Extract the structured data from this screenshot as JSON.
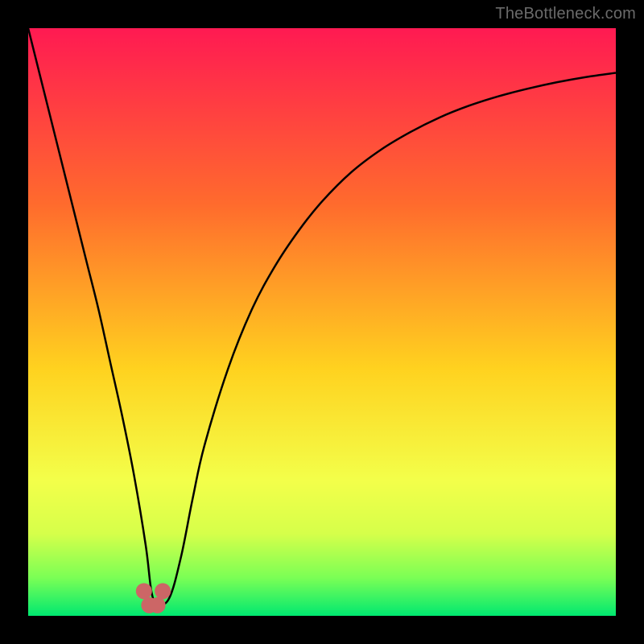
{
  "attribution": "TheBottleneck.com",
  "colors": {
    "frame": "#000000",
    "gradient_top": "#ff1a52",
    "gradient_upper_mid": "#ff6b2d",
    "gradient_mid": "#ffd21f",
    "gradient_lower_mid": "#f3ff4a",
    "gradient_low": "#d6ff4a",
    "gradient_green_start": "#7bff55",
    "gradient_green_end": "#00e870",
    "curve": "#000000",
    "markers": "#cc6666"
  },
  "chart_data": {
    "type": "line",
    "title": "",
    "xlabel": "",
    "ylabel": "",
    "xlim": [
      0,
      100
    ],
    "ylim": [
      0,
      100
    ],
    "series": [
      {
        "name": "bottleneck-curve",
        "x": [
          0,
          2,
          4,
          6,
          8,
          10,
          12,
          14,
          16,
          18,
          20,
          21,
          22,
          24,
          26,
          28,
          30,
          34,
          38,
          42,
          46,
          50,
          55,
          60,
          65,
          70,
          75,
          80,
          85,
          90,
          95,
          100
        ],
        "y": [
          100,
          92,
          84,
          76,
          68,
          60,
          52,
          43,
          34,
          24,
          12,
          4,
          2,
          3,
          10,
          20,
          29,
          42,
          52,
          59.5,
          65.5,
          70.5,
          75.5,
          79.3,
          82.3,
          84.8,
          86.8,
          88.4,
          89.7,
          90.8,
          91.7,
          92.4
        ]
      }
    ],
    "markers": {
      "name": "valley-markers",
      "x": [
        19.7,
        20.6,
        22.0,
        22.9
      ],
      "y": [
        4.2,
        1.8,
        1.8,
        4.2
      ]
    },
    "gradient_stops": [
      {
        "offset": 0.0,
        "color_key": "gradient_top"
      },
      {
        "offset": 0.3,
        "color_key": "gradient_upper_mid"
      },
      {
        "offset": 0.58,
        "color_key": "gradient_mid"
      },
      {
        "offset": 0.77,
        "color_key": "gradient_lower_mid"
      },
      {
        "offset": 0.86,
        "color_key": "gradient_low"
      },
      {
        "offset": 0.935,
        "color_key": "gradient_green_start"
      },
      {
        "offset": 1.0,
        "color_key": "gradient_green_end"
      }
    ]
  }
}
